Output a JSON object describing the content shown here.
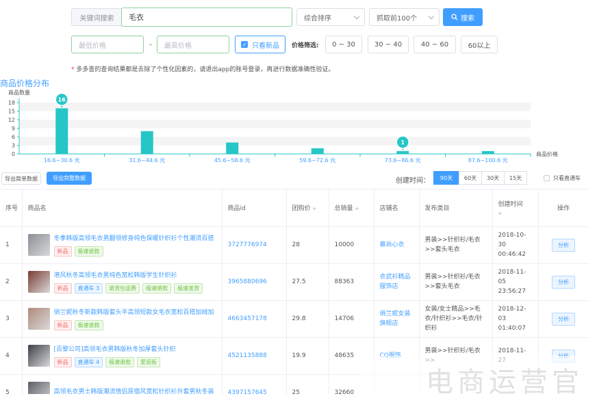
{
  "search": {
    "label": "关键词搜索",
    "keyword": "毛衣",
    "sort_value": "综合排序",
    "limit_value": "抓取前100个",
    "search_button": "搜索"
  },
  "price_filter": {
    "min_placeholder": "最低价格",
    "max_placeholder": "最高价格",
    "separator": "-",
    "new_only_label": "只看新品",
    "range_label": "价格筛选:",
    "ranges": [
      "0 ~ 30",
      "30 ~ 40",
      "40 ~ 60",
      "60以上"
    ]
  },
  "note": {
    "star": "*",
    "text": "多多查的查询结果都是去除了个性化因素的，请退出app的账号登录，再进行数据准确性验证。"
  },
  "chart_data": {
    "type": "bar",
    "title": "商品价格分布",
    "ylabel": "商品数量",
    "xlabel": "商品价格",
    "ylim": [
      0,
      18
    ],
    "yticks": [
      0,
      3,
      6,
      9,
      12,
      15,
      18
    ],
    "categories": [
      "16.6~30.6 元",
      "31.6~44.6 元",
      "45.6~58.6 元",
      "59.6~72.6 元",
      "73.6~86.6 元",
      "87.6~100.6 元"
    ],
    "values": [
      16,
      8,
      4,
      2,
      1,
      1
    ],
    "annotations": [
      {
        "index": 0,
        "label": "16"
      },
      {
        "index": 4,
        "label": "1"
      }
    ],
    "color": "#26c6c6",
    "grid": true
  },
  "toolbar": {
    "export_simple": "导出简单数据",
    "export_full": "导出完整数据",
    "create_time_label": "创建时间：",
    "time_tabs": [
      "90天",
      "60天",
      "30天",
      "15天"
    ],
    "active_tab": "90天",
    "direct_train_label": "只看直通车"
  },
  "table": {
    "headers": {
      "index": "序号",
      "name": "商品名",
      "id": "商品id",
      "group_price": "团购价",
      "total_sales": "总销量",
      "shop": "店铺名",
      "category": "发布类目",
      "created": "创建时间",
      "op": "操作"
    },
    "sort_glyph": "≑",
    "rows": [
      {
        "index": "1",
        "name": "冬季韩版高领毛衣男翻领修身纯色保暖针织衫个性潮流百搭",
        "tags": [
          {
            "text": "新品",
            "kind": "red"
          },
          {
            "text": "极速退款",
            "kind": "green"
          }
        ],
        "id": "3727776974",
        "price": "28",
        "sales": "10000",
        "shop": "慕尚心衣",
        "category": "男装>>针织衫/毛衣>>套头毛衣",
        "created": "2018-10-30 00:46:42",
        "op": "分析",
        "thumb_color": "#8a8f96"
      },
      {
        "index": "2",
        "name": "港风秋冬高领毛衣男纯色宽松韩版学生针织衫",
        "tags": [
          {
            "text": "新品",
            "kind": "red"
          },
          {
            "text": "直通车 3",
            "kind": "blue"
          },
          {
            "text": "退货包运费",
            "kind": "green"
          },
          {
            "text": "极速退款",
            "kind": "green"
          },
          {
            "text": "极速发货",
            "kind": "green"
          }
        ],
        "id": "3965880696",
        "price": "27.5",
        "sales": "88363",
        "shop": "衣武衫精品服饰店",
        "category": "男装>>针织衫/毛衣>>套头毛衣",
        "created": "2018-11-05 23:56:27",
        "op": "分析",
        "thumb_color": "#7a3b32"
      },
      {
        "index": "3",
        "name": "俏兰妮秋冬新款韩版套头半高领短款女毛衣宽松百搭加绒加",
        "tags": [
          {
            "text": "新品",
            "kind": "red"
          },
          {
            "text": "极速退款",
            "kind": "green"
          }
        ],
        "id": "4663457178",
        "price": "29.8",
        "sales": "14706",
        "shop": "俏兰妮女装旗舰店",
        "category": "女装/女士精品>>毛衣/针织衫>>毛衣/针织衫",
        "created": "2018-12-03 01:40:07",
        "op": "分析",
        "thumb_color": "#b08a7a"
      },
      {
        "index": "4",
        "name": "[百黎公司]高领毛衣男韩版秋冬加厚套头针织",
        "tags": [
          {
            "text": "新品",
            "kind": "red"
          },
          {
            "text": "直通车 4",
            "kind": "blue"
          },
          {
            "text": "极速退款",
            "kind": "green"
          },
          {
            "text": "爱逛街",
            "kind": "green"
          }
        ],
        "id": "4521135888",
        "price": "19.9",
        "sales": "48635",
        "shop": "CQ服饰",
        "category": "男装>>针织衫/毛衣>>",
        "created": "2018-11-27",
        "op": "分析",
        "thumb_color": "#3c3f48"
      },
      {
        "index": "5",
        "name": "高领毛衣男士韩版潮流情侣原宿风宽松针织衫外套男秋冬装",
        "tags": [],
        "id": "4397157645",
        "price": "25",
        "sales": "32660",
        "shop": "",
        "category": "",
        "created": "",
        "op": "",
        "thumb_color": "#5a5d66"
      }
    ]
  },
  "watermark": "电商运营官"
}
